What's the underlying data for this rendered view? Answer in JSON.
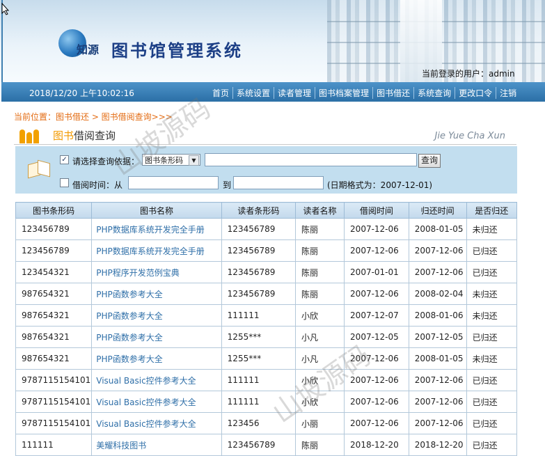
{
  "header": {
    "logo_text": "知源",
    "system_title": "图书馆管理系统",
    "current_user_label": "当前登录的用户：admin"
  },
  "navbar": {
    "datetime": "2018/12/20 上午10:02:16",
    "items": [
      "首页",
      "系统设置",
      "读者管理",
      "图书档案管理",
      "图书借还",
      "系统查询",
      "更改口令",
      "注销"
    ]
  },
  "breadcrumb": "当前位置：图书借还 > 图书借阅查询>>>",
  "section": {
    "title_accent": "图书",
    "title_rest": "借阅查询",
    "pinyin": "Jie Yue Cha Xun"
  },
  "search": {
    "criteria_label": "请选择查询依据：",
    "criteria_checked": true,
    "select_value": "图书条形码",
    "keyword_value": "",
    "query_button": "查询",
    "date_checked": false,
    "date_label": "借阅时间：从",
    "from_value": "",
    "to_label": "到",
    "to_value": "",
    "date_format_hint": "(日期格式为：2007-12-01)"
  },
  "table": {
    "headers": [
      "图书条形码",
      "图书名称",
      "读者条形码",
      "读者名称",
      "借阅时间",
      "归还时间",
      "是否归还"
    ],
    "rows": [
      [
        "123456789",
        "PHP数据库系统开发完全手册",
        "123456789",
        "陈丽",
        "2007-12-06",
        "2008-01-05",
        "未归还"
      ],
      [
        "123456789",
        "PHP数据库系统开发完全手册",
        "123456789",
        "陈丽",
        "2007-12-06",
        "2007-12-06",
        "已归还"
      ],
      [
        "123454321",
        "PHP程序开发范例宝典",
        "123456789",
        "陈丽",
        "2007-01-01",
        "2007-12-06",
        "已归还"
      ],
      [
        "987654321",
        "PHP函数参考大全",
        "123456789",
        "陈丽",
        "2007-12-06",
        "2008-02-04",
        "未归还"
      ],
      [
        "987654321",
        "PHP函数参考大全",
        "111111",
        "小欣",
        "2007-12-07",
        "2008-01-06",
        "未归还"
      ],
      [
        "987654321",
        "PHP函数参考大全",
        "1255***",
        "小凡",
        "2007-12-05",
        "2007-12-05",
        "已归还"
      ],
      [
        "987654321",
        "PHP函数参考大全",
        "1255***",
        "小凡",
        "2007-12-06",
        "2008-01-05",
        "未归还"
      ],
      [
        "9787115154101",
        "Visual Basic控件参考大全",
        "111111",
        "小欣",
        "2007-12-06",
        "2007-12-06",
        "已归还"
      ],
      [
        "9787115154101",
        "Visual Basic控件参考大全",
        "111111",
        "小欣",
        "2007-12-06",
        "2007-12-06",
        "已归还"
      ],
      [
        "9787115154101",
        "Visual Basic控件参考大全",
        "123456",
        "小丽",
        "2007-12-06",
        "2007-12-06",
        "已归还"
      ],
      [
        "111111",
        "美耀科技图书",
        "123456789",
        "陈丽",
        "2018-12-20",
        "2018-12-20",
        "已归还"
      ]
    ]
  },
  "watermark_text": "山坡源码"
}
